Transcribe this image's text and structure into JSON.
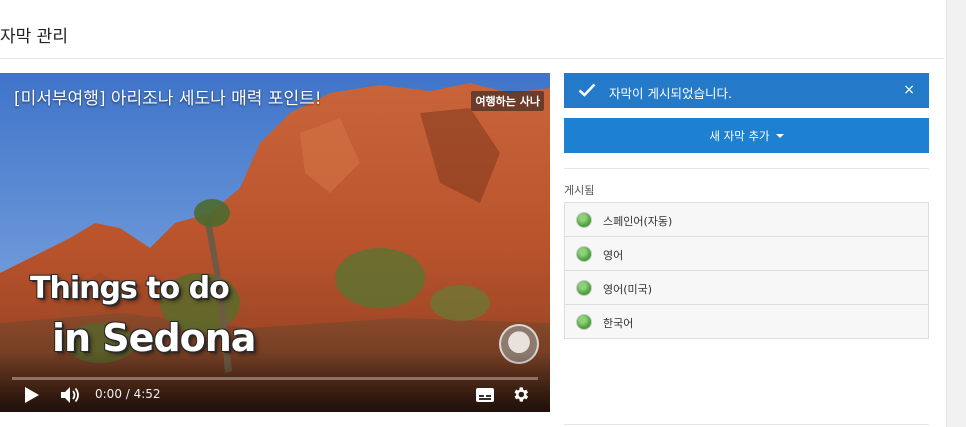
{
  "page": {
    "title": "자막 관리"
  },
  "video": {
    "title": "[미서부여행] 아리조나 세도나 매력 포인트!",
    "channel_badge": "여행하는 사나",
    "overlay_line1": "Things to do",
    "overlay_line2": "in Sedona",
    "time": "0:00 / 4:52",
    "progress": 0,
    "icons": [
      "play-icon",
      "volume-icon",
      "captions-icon",
      "gear-icon"
    ]
  },
  "panel": {
    "alert": {
      "text": "자막이 게시되었습니다.",
      "close": "×",
      "icon": "check-icon",
      "color": "#2479c8"
    },
    "add_button": {
      "label": "새 자막 추가",
      "color": "#1d80d0"
    },
    "published_label": "게시됨",
    "languages": [
      {
        "name": "스페인어(자동)",
        "status": "published"
      },
      {
        "name": "영어",
        "status": "published"
      },
      {
        "name": "영어(미국)",
        "status": "published"
      },
      {
        "name": "한국어",
        "status": "published"
      }
    ],
    "status_color": "#4fa53e"
  }
}
